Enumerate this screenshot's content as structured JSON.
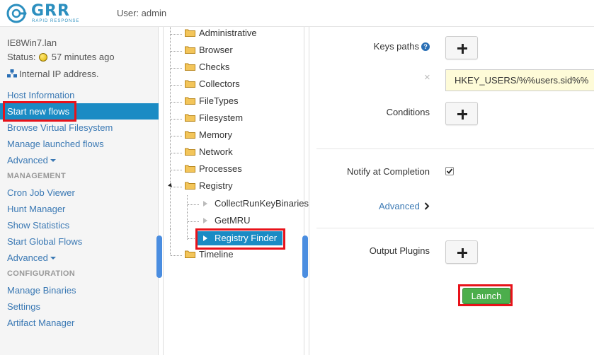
{
  "header": {
    "logo_text": "GRR",
    "logo_sub": "RAPID RESPONSE",
    "user_label": "User: admin"
  },
  "client": {
    "hostname": "IE8Win7.lan",
    "status_prefix": "Status:",
    "status_time": "57 minutes ago",
    "ip_info": "Internal IP address."
  },
  "nav": {
    "host_information": "Host Information",
    "start_new_flows": "Start new flows",
    "browse_vfs": "Browse Virtual Filesystem",
    "manage_flows": "Manage launched flows",
    "advanced_1": "Advanced",
    "management_head": "MANAGEMENT",
    "cron_job_viewer": "Cron Job Viewer",
    "hunt_manager": "Hunt Manager",
    "show_statistics": "Show Statistics",
    "start_global_flows": "Start Global Flows",
    "advanced_2": "Advanced",
    "configuration_head": "CONFIGURATION",
    "manage_binaries": "Manage Binaries",
    "settings": "Settings",
    "artifact_manager": "Artifact Manager"
  },
  "tree": {
    "folders": [
      "Administrative",
      "Browser",
      "Checks",
      "Collectors",
      "FileTypes",
      "Filesystem",
      "Memory",
      "Network",
      "Processes",
      "Registry"
    ],
    "registry_children": [
      "CollectRunKeyBinaries",
      "GetMRU",
      "Registry Finder"
    ],
    "last_folder": "Timeline"
  },
  "form": {
    "keys_paths_label": "Keys paths",
    "keys_path_value": "HKEY_USERS/%%users.sid%%",
    "remove_symbol": "×",
    "conditions_label": "Conditions",
    "notify_label": "Notify at Completion",
    "advanced_link": "Advanced",
    "output_plugins_label": "Output Plugins",
    "launch_button": "Launch"
  },
  "colors": {
    "accent": "#1a8bc4",
    "link": "#3b79b4",
    "highlight_box": "#e8121a",
    "launch_green": "#4cae4c",
    "input_bg": "#fefbd8"
  }
}
